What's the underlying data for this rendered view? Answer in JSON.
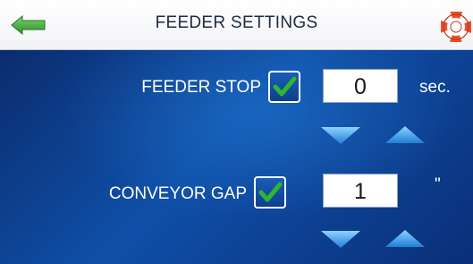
{
  "header": {
    "title": "FEEDER SETTINGS",
    "back_icon": "left-arrow-icon",
    "help_icon": "lifebuoy-icon"
  },
  "settings": [
    {
      "label": "FEEDER STOP",
      "checked": true,
      "value": "0",
      "unit": "sec."
    },
    {
      "label": "CONVEYOR GAP",
      "checked": true,
      "value": "1",
      "unit": "\""
    }
  ],
  "colors": {
    "panel_blue": "#0f4fa8",
    "check_green": "#2fb52f",
    "arrow_cyan": "#39a8ee",
    "back_arrow_green": "#3aa53a",
    "help_orange": "#e8502a"
  }
}
